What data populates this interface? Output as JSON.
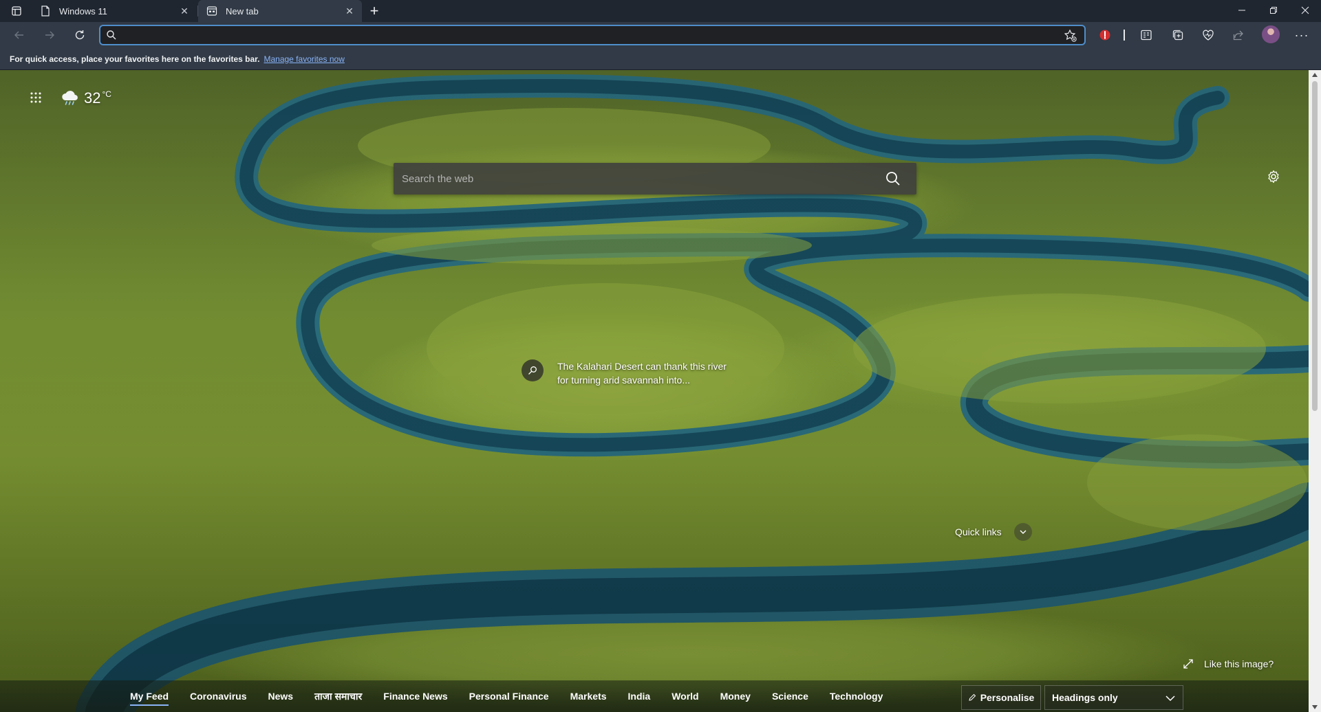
{
  "browser": {
    "tabs": [
      {
        "title": "Windows 11",
        "active": false
      },
      {
        "title": "New tab",
        "active": true
      }
    ],
    "new_tab_symbol": "+",
    "address_bar": {
      "value": "",
      "placeholder": ""
    },
    "favorites_bar": {
      "message": "For quick access, place your favorites here on the favorites bar.",
      "link": "Manage favorites now"
    },
    "toolbar_more": "···"
  },
  "ntp": {
    "weather": {
      "temperature": "32",
      "unit": "°C",
      "icon": "cloud-rain-icon"
    },
    "search": {
      "placeholder": "Search the web"
    },
    "image_info": "The Kalahari Desert can thank this river for turning arid savannah into...",
    "quick_links": "Quick links",
    "like_image": "Like this image?",
    "feed": {
      "items": [
        "My Feed",
        "Coronavirus",
        "News",
        "ताजा समाचार",
        "Finance News",
        "Personal Finance",
        "Markets",
        "India",
        "World",
        "Money",
        "Science",
        "Technology"
      ],
      "active_index": 0,
      "personalise": "Personalise",
      "layout_option": "Headings only"
    }
  },
  "colors": {
    "accent": "#4f8ecb",
    "toolbar": "#313a46",
    "titlebar": "#1f2630",
    "river": "#1f5a6a",
    "grass": "#7a9332"
  }
}
